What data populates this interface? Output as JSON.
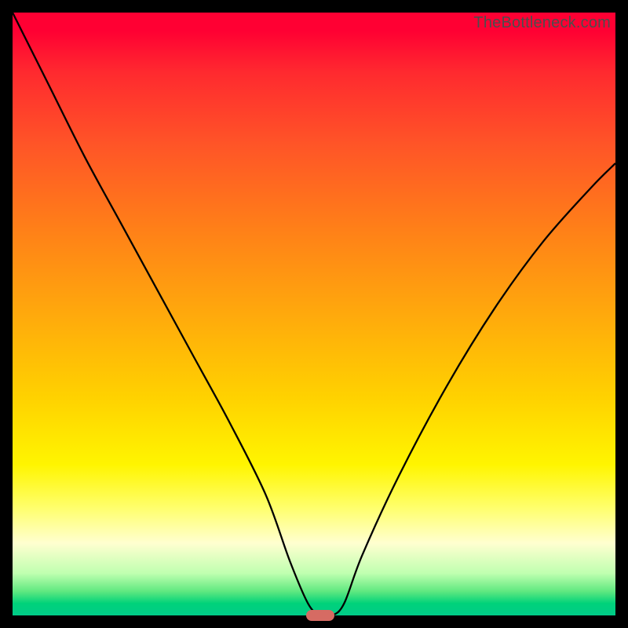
{
  "watermark": "TheBottleneck.com",
  "colors": {
    "gradient_top": "#ff0033",
    "gradient_mid": "#ffd200",
    "gradient_bottom": "#00cc88",
    "curve_stroke": "#000000",
    "marker_fill": "#d66b63",
    "frame": "#000000"
  },
  "chart_data": {
    "type": "line",
    "title": "",
    "xlabel": "",
    "ylabel": "",
    "xlim": [
      0,
      100
    ],
    "ylim": [
      0,
      100
    ],
    "x": [
      0,
      6,
      12,
      18,
      24,
      30,
      36,
      42,
      46,
      49,
      51,
      53,
      55,
      58,
      64,
      72,
      80,
      88,
      96,
      100
    ],
    "values": [
      100,
      88,
      76,
      65,
      54,
      43,
      32,
      20,
      9,
      2,
      0,
      0,
      2,
      10,
      23,
      38,
      51,
      62,
      71,
      75
    ],
    "marker": {
      "x": 51,
      "y": 0,
      "width": 4.7,
      "height": 1.9
    },
    "notes": "Background vertical gradient red→yellow→green represents bottleneck severity; curve shows single V-shaped minimum near x≈51."
  }
}
